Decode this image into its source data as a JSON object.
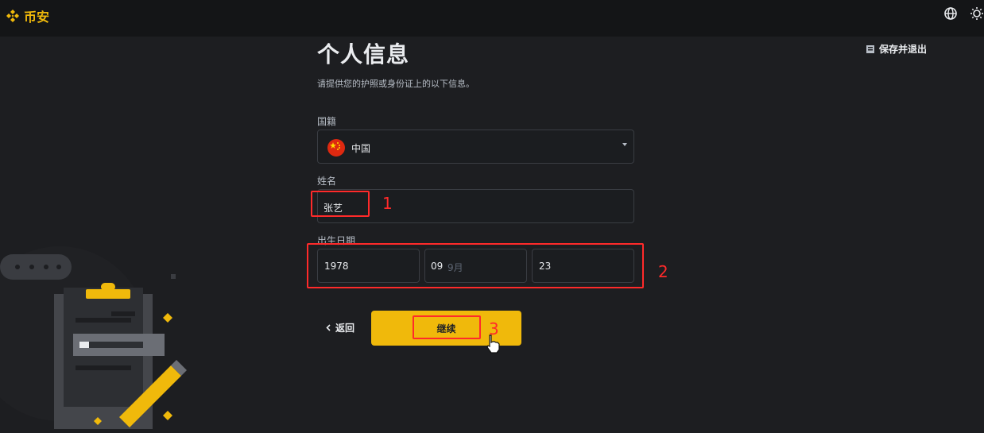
{
  "app": {
    "logo_text": "币安"
  },
  "header": {
    "save_exit": "保存并退出"
  },
  "form": {
    "title": "个人信息",
    "subtitle": "请提供您的护照或身份证上的以下信息。",
    "nationality": {
      "label": "国籍",
      "value": "中国"
    },
    "name": {
      "label": "姓名",
      "value": "张艺"
    },
    "dob": {
      "label": "出生日期",
      "year": "1978",
      "month": "09",
      "month_placeholder": "9月",
      "day": "23"
    },
    "back_label": "返回",
    "continue_label": "继续"
  },
  "annotations": {
    "one": "1",
    "two": "2",
    "three": "3"
  },
  "colors": {
    "accent": "#f0b90b",
    "annotation": "#ff2a2a",
    "background": "#1d1e21"
  },
  "icons": [
    "binance-logo-icon",
    "globe-icon",
    "theme-icon",
    "save-icon",
    "chevron-down-icon",
    "china-flag-icon",
    "chevron-left-icon",
    "hand-cursor-icon"
  ]
}
